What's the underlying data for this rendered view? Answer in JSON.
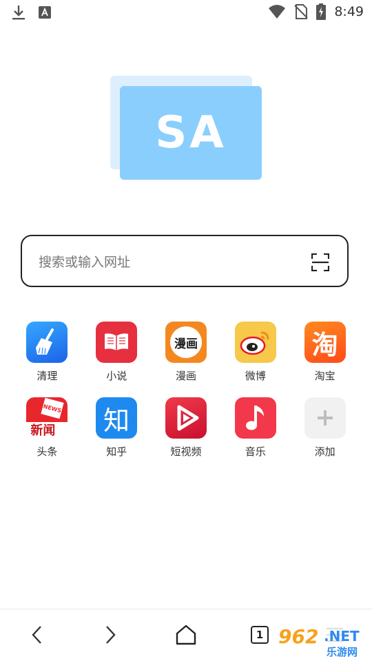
{
  "status_bar": {
    "time": "8:49",
    "icons": [
      "download-icon",
      "keyboard-a-icon",
      "wifi-icon",
      "no-sim-icon",
      "battery-charging-icon"
    ]
  },
  "logo": {
    "text": "SA",
    "front_color": "#8ACEFD",
    "back_color": "#DDEFFD"
  },
  "search": {
    "placeholder": "搜索或输入网址",
    "value": "",
    "scan_icon": "scan-icon"
  },
  "shortcuts": [
    {
      "label": "清理",
      "icon": "broom-icon",
      "color": "#2F8BF6"
    },
    {
      "label": "小说",
      "icon": "open-book-icon",
      "color": "#E6303F"
    },
    {
      "label": "漫画",
      "icon": "comic-icon",
      "color": "#F48820",
      "icon_text": "漫画"
    },
    {
      "label": "微博",
      "icon": "weibo-icon",
      "color": "#F6C94A"
    },
    {
      "label": "淘宝",
      "icon": "taobao-icon",
      "color": "#FF5A1F",
      "icon_text": "淘"
    },
    {
      "label": "头条",
      "icon": "news-icon",
      "color": "#E8272C",
      "icon_text": "新闻",
      "icon_subtext": "NEWS"
    },
    {
      "label": "知乎",
      "icon": "zhihu-icon",
      "color": "#1E8AF0",
      "icon_text": "知"
    },
    {
      "label": "短视频",
      "icon": "short-video-icon",
      "color": "#E3263E"
    },
    {
      "label": "音乐",
      "icon": "music-note-icon",
      "color": "#F2384A"
    },
    {
      "label": "添加",
      "icon": "plus-icon",
      "color": "#F1F1F1"
    }
  ],
  "bottom_nav": {
    "back_icon": "chevron-left-icon",
    "forward_icon": "chevron-right-icon",
    "home_icon": "home-icon",
    "tab_count": "1",
    "menu_icon": "menu-icon"
  },
  "watermark": {
    "number": "962",
    "domain": ".NET",
    "site_name": "乐游网"
  }
}
